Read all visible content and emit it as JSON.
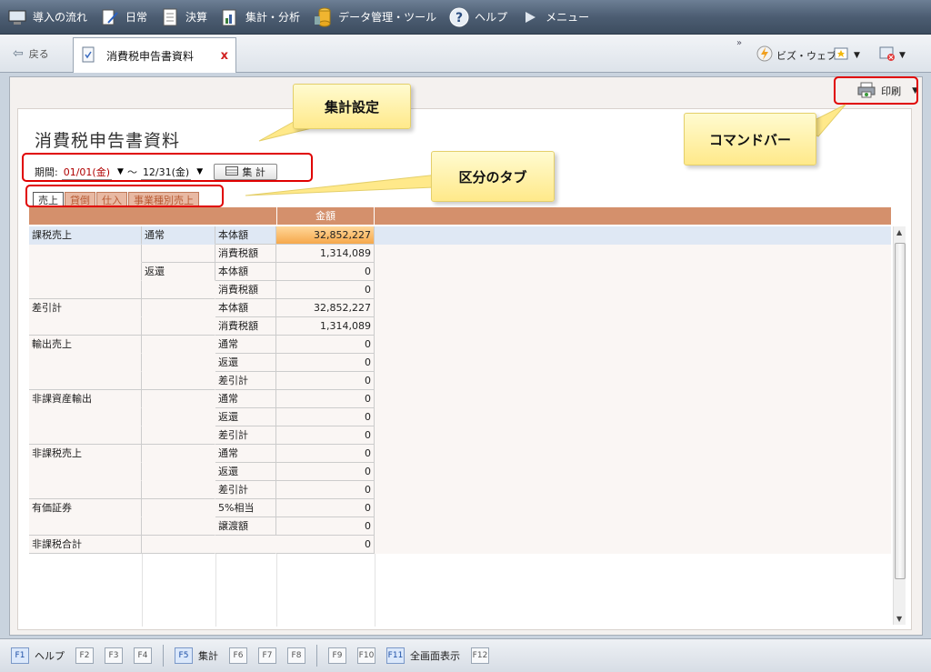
{
  "menu": [
    {
      "label": "導入の流れ",
      "icon": "computer-icon"
    },
    {
      "label": "日常",
      "icon": "pen-document-icon"
    },
    {
      "label": "決算",
      "icon": "document-icon"
    },
    {
      "label": "集計・分析",
      "icon": "bar-chart-icon"
    },
    {
      "label": "データ管理・ツール",
      "icon": "database-icon"
    },
    {
      "label": "ヘルプ",
      "icon": "help-icon"
    },
    {
      "label": "メニュー",
      "icon": "play-icon"
    }
  ],
  "tabbar": {
    "back_label": "戻る",
    "doc_tab_label": "消費税申告書資料",
    "close_glyph": "x",
    "chevron": "»",
    "bizweb_label": "ビズ・ウェブ"
  },
  "command": {
    "print_label": "印刷"
  },
  "page": {
    "title": "消費税申告書資料",
    "period_label": "期間:",
    "from_value": "01/01(金)",
    "tilde": "～",
    "to_value": "12/31(金)",
    "calc_button": "集 計"
  },
  "tabs": [
    "売上",
    "貸倒",
    "仕入",
    "事業種別売上"
  ],
  "table": {
    "amount_header": "金額",
    "rows": [
      {
        "c1": "課税売上",
        "c2": "通常",
        "c3": "本体額",
        "v": "32,852,227"
      },
      {
        "c1": "",
        "c2": "",
        "c3": "消費税額",
        "v": "1,314,089"
      },
      {
        "c1": "",
        "c2": "返還",
        "c3": "本体額",
        "v": "0"
      },
      {
        "c1": "",
        "c2": "",
        "c3": "消費税額",
        "v": "0"
      },
      {
        "c1": "差引計",
        "c2": "",
        "c3": "本体額",
        "v": "32,852,227"
      },
      {
        "c1": "",
        "c2": "",
        "c3": "消費税額",
        "v": "1,314,089"
      },
      {
        "c1": "輸出売上",
        "c2": "",
        "c3": "通常",
        "v": "0"
      },
      {
        "c1": "",
        "c2": "",
        "c3": "返還",
        "v": "0"
      },
      {
        "c1": "",
        "c2": "",
        "c3": "差引計",
        "v": "0"
      },
      {
        "c1": "非課資産輸出",
        "c2": "",
        "c3": "通常",
        "v": "0"
      },
      {
        "c1": "",
        "c2": "",
        "c3": "返還",
        "v": "0"
      },
      {
        "c1": "",
        "c2": "",
        "c3": "差引計",
        "v": "0"
      },
      {
        "c1": "非課税売上",
        "c2": "",
        "c3": "通常",
        "v": "0"
      },
      {
        "c1": "",
        "c2": "",
        "c3": "返還",
        "v": "0"
      },
      {
        "c1": "",
        "c2": "",
        "c3": "差引計",
        "v": "0"
      },
      {
        "c1": "有価証券",
        "c2": "",
        "c3": "5%相当",
        "v": "0"
      },
      {
        "c1": "",
        "c2": "",
        "c3": "譲渡額",
        "v": "0"
      },
      {
        "c1": "非課税合計",
        "c2": "",
        "c3": "",
        "v": "0"
      }
    ]
  },
  "callouts": {
    "settings": "集計設定",
    "tabs": "区分のタブ",
    "command": "コマンドバー"
  },
  "fkeys": [
    {
      "key": "F1",
      "label": "ヘルプ",
      "on": true
    },
    {
      "key": "F2",
      "label": ""
    },
    {
      "key": "F3",
      "label": ""
    },
    {
      "key": "F4",
      "label": ""
    },
    {
      "key": "F5",
      "label": "集計",
      "on": true
    },
    {
      "key": "F6",
      "label": ""
    },
    {
      "key": "F7",
      "label": ""
    },
    {
      "key": "F8",
      "label": ""
    },
    {
      "key": "F9",
      "label": ""
    },
    {
      "key": "F10",
      "label": ""
    },
    {
      "key": "F11",
      "label": "全画面表示",
      "on": true
    },
    {
      "key": "F12",
      "label": ""
    }
  ],
  "colors": {
    "header": "#d4906c",
    "highlight": "#f6a84b",
    "annotation": "#e00000",
    "callout": "#ffe98a"
  }
}
